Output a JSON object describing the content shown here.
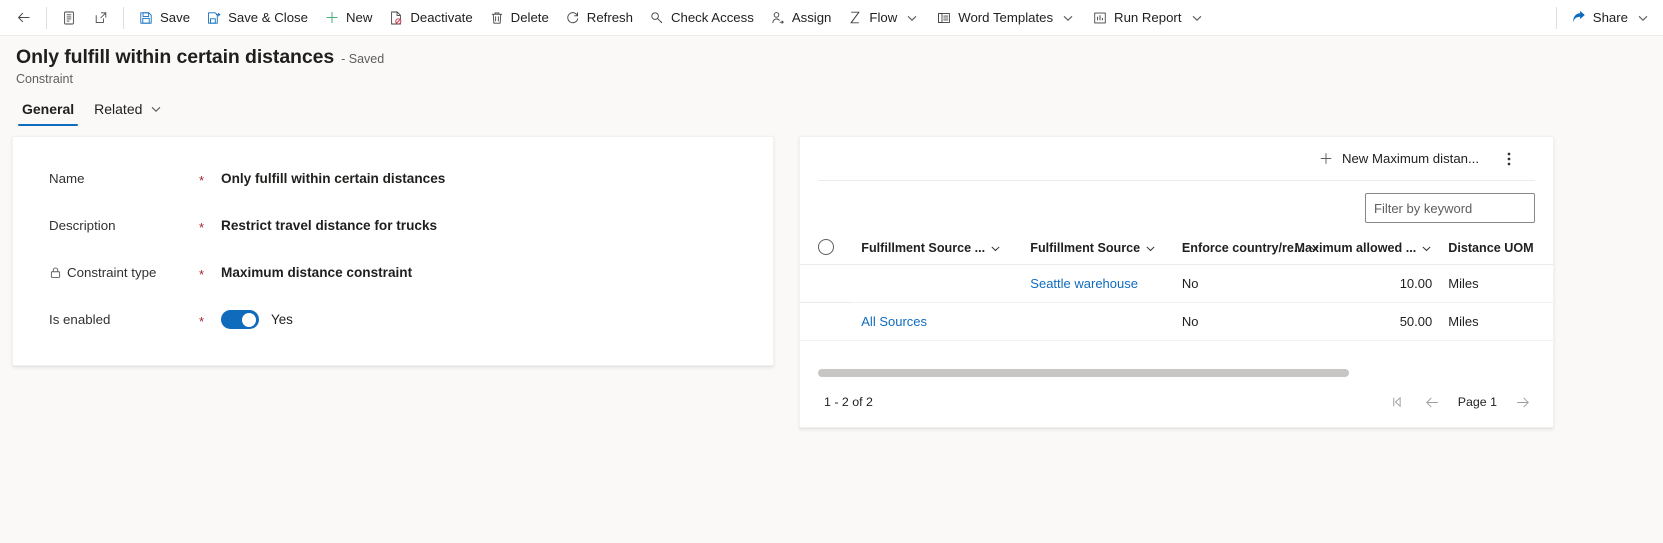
{
  "commandbar": {
    "back_label": "Back",
    "form_selector_label": "Form selector",
    "popout_label": "Pop out",
    "buttons": [
      {
        "label": "Save",
        "icon": "save-icon"
      },
      {
        "label": "Save & Close",
        "icon": "save-and-close-icon"
      },
      {
        "label": "New",
        "icon": "plus-icon"
      },
      {
        "label": "Deactivate",
        "icon": "deactivate-icon"
      },
      {
        "label": "Delete",
        "icon": "trash-icon"
      },
      {
        "label": "Refresh",
        "icon": "refresh-icon"
      },
      {
        "label": "Check Access",
        "icon": "key-icon"
      },
      {
        "label": "Assign",
        "icon": "assign-person-icon"
      },
      {
        "label": "Flow",
        "icon": "flow-icon",
        "caret": true
      },
      {
        "label": "Word Templates",
        "icon": "word-template-icon",
        "caret": true
      },
      {
        "label": "Run Report",
        "icon": "report-icon",
        "caret": true
      }
    ],
    "share": {
      "label": "Share",
      "icon": "share-icon",
      "caret": true
    }
  },
  "header": {
    "title": "Only fulfill within certain distances",
    "saved_state": "- Saved",
    "entity": "Constraint"
  },
  "tabs": [
    {
      "label": "General",
      "selected": true,
      "caret": false
    },
    {
      "label": "Related",
      "selected": false,
      "caret": true
    }
  ],
  "form": {
    "fields": [
      {
        "label": "Name",
        "required": "*",
        "value": "Only fulfill within certain distances",
        "locked": false
      },
      {
        "label": "Description",
        "required": "*",
        "value": "Restrict travel distance for trucks",
        "locked": false
      },
      {
        "label": "Constraint type",
        "required": "*",
        "value": "Maximum distance constraint",
        "locked": true
      },
      {
        "label": "Is enabled",
        "required": "*",
        "value": "Yes",
        "locked": false,
        "toggle": true,
        "toggle_on": true
      }
    ]
  },
  "subgrid": {
    "new_button_label": "New Maximum distan...",
    "new_button_icon": "plus-icon",
    "overflow_label": "More commands",
    "filter_placeholder": "Filter by keyword",
    "columns": [
      {
        "label": "Fulfillment Source ...",
        "caret": true,
        "align": "left"
      },
      {
        "label": "Fulfillment Source",
        "caret": true,
        "align": "left"
      },
      {
        "label": "Enforce country/re...",
        "caret": true,
        "align": "left"
      },
      {
        "label": "Maximum allowed ...",
        "caret": true,
        "align": "right"
      },
      {
        "label": "Distance UOM",
        "caret": false,
        "align": "left"
      }
    ],
    "rows": [
      {
        "fulfillment_source_group": "",
        "fulfillment_source": "Seattle warehouse",
        "enforce_country": "No",
        "maximum_allowed": "10.00",
        "distance_uom": "Miles"
      },
      {
        "fulfillment_source_group": "All Sources",
        "fulfillment_source": "",
        "enforce_country": "No",
        "maximum_allowed": "50.00",
        "distance_uom": "Miles"
      }
    ],
    "footer": {
      "record_count": "1 - 2 of 2",
      "page_label": "Page 1",
      "first_page_label": "First page",
      "prev_page_label": "Previous page",
      "next_page_label": "Next page"
    }
  },
  "colors": {
    "accent": "#0f6cbd",
    "required": "#a4262c",
    "link": "#0f6cbd",
    "page_bg": "#faf9f8",
    "card_bg": "#ffffff"
  }
}
